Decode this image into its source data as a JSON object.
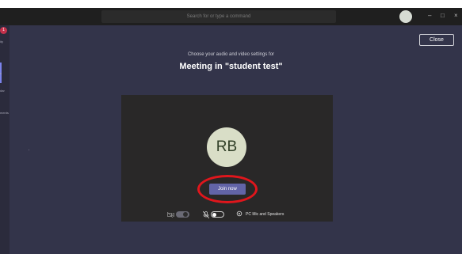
{
  "titlebar": {
    "search_placeholder": "Search for or type a command",
    "avatar_initials": "",
    "minimize_glyph": "–",
    "maximize_glyph": "□",
    "close_glyph": "×"
  },
  "rail": {
    "badge": "1",
    "items": [
      "ity",
      "s",
      "dar",
      "ments"
    ]
  },
  "close_label": "Close",
  "subtitle": "Choose your audio and video settings for",
  "meeting_title": "Meeting in \"student test\"",
  "preview": {
    "avatar_initials": "RB",
    "join_label": "Join now",
    "audio_label": "PC Mic and Speakers"
  },
  "colors": {
    "background": "#33344a",
    "accent": "#6264a7",
    "annotation": "#e0161c",
    "avatar_bg": "#d9dec7"
  },
  "icons": [
    "camera-off-icon",
    "mic-off-icon",
    "gear-icon",
    "chevron-icon"
  ]
}
